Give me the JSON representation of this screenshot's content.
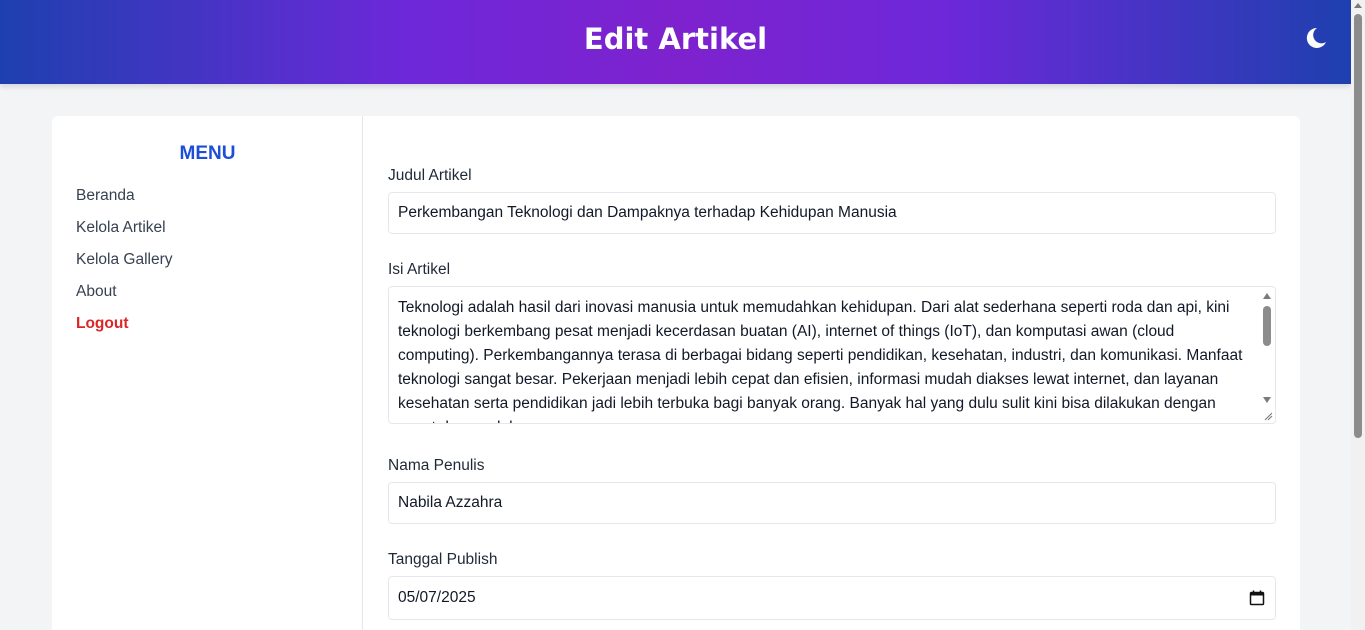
{
  "header": {
    "title": "Edit Artikel",
    "theme_toggle_icon": "moon-icon"
  },
  "sidebar": {
    "title": "MENU",
    "items": [
      {
        "label": "Beranda"
      },
      {
        "label": "Kelola Artikel"
      },
      {
        "label": "Kelola Gallery"
      },
      {
        "label": "About"
      },
      {
        "label": "Logout"
      }
    ]
  },
  "form": {
    "judul": {
      "label": "Judul Artikel",
      "value": "Perkembangan Teknologi dan Dampaknya terhadap Kehidupan Manusia"
    },
    "isi": {
      "label": "Isi Artikel",
      "value": "Teknologi adalah hasil dari inovasi manusia untuk memudahkan kehidupan. Dari alat sederhana seperti roda dan api, kini teknologi berkembang pesat menjadi kecerdasan buatan (AI), internet of things (IoT), dan komputasi awan (cloud computing). Perkembangannya terasa di berbagai bidang seperti pendidikan, kesehatan, industri, dan komunikasi. Manfaat teknologi sangat besar. Pekerjaan menjadi lebih cepat dan efisien, informasi mudah diakses lewat internet, dan layanan kesehatan serta pendidikan jadi lebih terbuka bagi banyak orang. Banyak hal yang dulu sulit kini bisa dilakukan dengan cepat dan mudah."
    },
    "penulis": {
      "label": "Nama Penulis",
      "value": "Nabila Azzahra"
    },
    "tanggal": {
      "label": "Tanggal Publish",
      "value": "05/07/2025"
    }
  },
  "colors": {
    "accent": "#1d4ed8",
    "logout": "#dc2626",
    "header_gradient_start": "#1e40af",
    "header_gradient_mid": "#7e22ce"
  }
}
